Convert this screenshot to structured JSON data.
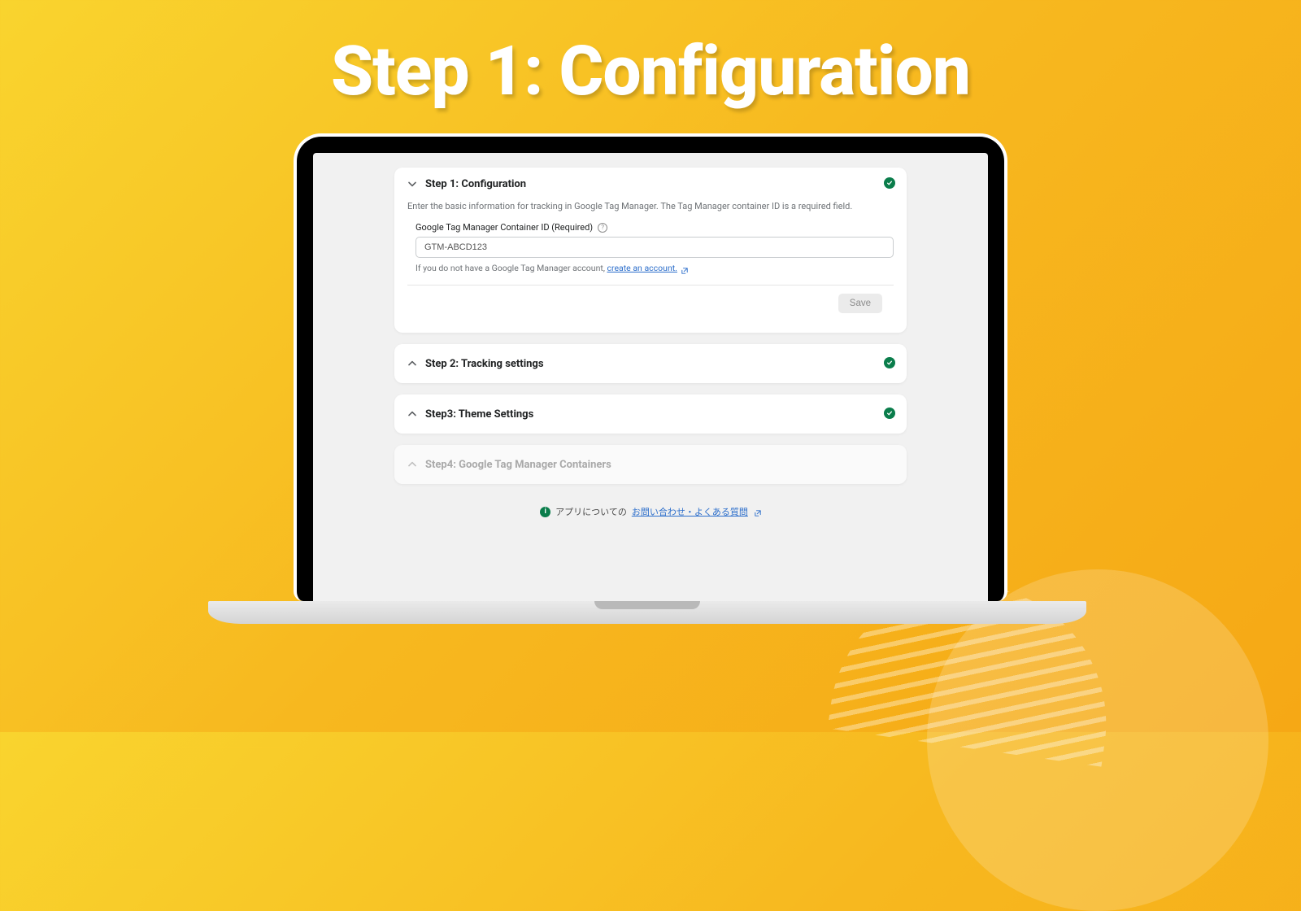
{
  "hero": {
    "title": "Step 1: Configuration"
  },
  "steps": {
    "s1": {
      "title": "Step 1: Configuration",
      "desc": "Enter the basic information for tracking in Google Tag Manager. The Tag Manager container ID is a required field.",
      "field_label": "Google Tag Manager Container ID (Required)",
      "input_value": "GTM-ABCD123",
      "helper_prefix": "If you do not have a Google Tag Manager account, ",
      "helper_link": "create an account.",
      "save_label": "Save"
    },
    "s2": {
      "title": "Step 2: Tracking settings"
    },
    "s3": {
      "title": "Step3: Theme Settings"
    },
    "s4": {
      "title": "Step4: Google Tag Manager Containers"
    }
  },
  "footer": {
    "prefix": "アプリについての",
    "link": "お問い合わせ・よくある質問"
  }
}
